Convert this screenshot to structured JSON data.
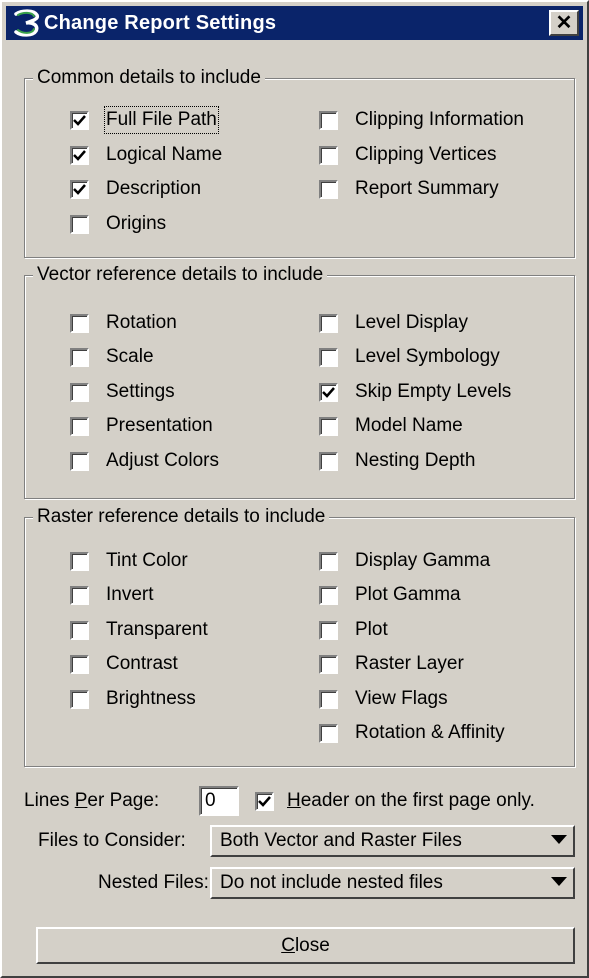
{
  "window": {
    "title": "Change Report Settings",
    "close_glyph": "✕",
    "icon": "microstation-logo-icon"
  },
  "common": {
    "legend": "Common details to include",
    "items": [
      {
        "label": "Full File Path",
        "checked": true
      },
      {
        "label": "Logical Name",
        "checked": true
      },
      {
        "label": "Description",
        "checked": true
      },
      {
        "label": "Origins",
        "checked": false
      },
      {
        "label": "Clipping Information",
        "checked": false
      },
      {
        "label": "Clipping Vertices",
        "checked": false
      },
      {
        "label": "Report Summary",
        "checked": false
      }
    ]
  },
  "vector": {
    "legend": "Vector reference details to include",
    "items": [
      {
        "label": "Rotation",
        "checked": false
      },
      {
        "label": "Scale",
        "checked": false
      },
      {
        "label": "Settings",
        "checked": false
      },
      {
        "label": "Presentation",
        "checked": false
      },
      {
        "label": "Adjust Colors",
        "checked": false
      },
      {
        "label": "Level Display",
        "checked": false
      },
      {
        "label": "Level Symbology",
        "checked": false
      },
      {
        "label": "Skip Empty Levels",
        "checked": true
      },
      {
        "label": "Model Name",
        "checked": false
      },
      {
        "label": "Nesting Depth",
        "checked": false
      }
    ]
  },
  "raster": {
    "legend": "Raster reference details to include",
    "items": [
      {
        "label": "Tint Color",
        "checked": false
      },
      {
        "label": "Invert",
        "checked": false
      },
      {
        "label": "Transparent",
        "checked": false
      },
      {
        "label": "Contrast",
        "checked": false
      },
      {
        "label": "Brightness",
        "checked": false
      },
      {
        "label": "Display Gamma",
        "checked": false
      },
      {
        "label": "Plot Gamma",
        "checked": false
      },
      {
        "label": "Plot",
        "checked": false
      },
      {
        "label": "Raster Layer",
        "checked": false
      },
      {
        "label": "View Flags",
        "checked": false
      },
      {
        "label": "Rotation & Affinity",
        "checked": false
      }
    ]
  },
  "options": {
    "lines_per_page_pre": "Lines ",
    "lines_per_page_key": "P",
    "lines_per_page_post": "er Page:",
    "lines_per_page_value": "0",
    "header_key": "H",
    "header_rest": "eader on the first page only.",
    "header_checked": true,
    "files_label": "Files to Consider:",
    "files_value": "Both Vector and Raster Files",
    "nested_label": "Nested Files:",
    "nested_value": "Do not include nested files"
  },
  "close_button": {
    "key": "C",
    "rest": "lose"
  }
}
